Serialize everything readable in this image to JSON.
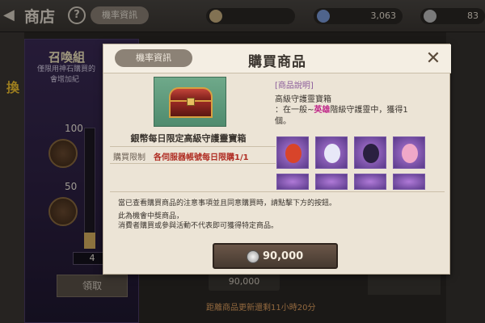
{
  "topbar": {
    "back_glyph": "◀",
    "title": "商店",
    "help_glyph": "?",
    "tab_label": "機率資訊",
    "currencies": [
      {
        "icon": "gem-icon",
        "value": ""
      },
      {
        "icon": "crystal-icon",
        "value": "3,063"
      },
      {
        "icon": "silver-coin-icon",
        "value": "83"
      }
    ]
  },
  "banner": {
    "title": "召喚組",
    "desc_line1": "僅限用神石購買的",
    "desc_line2": "會增加紀",
    "milestones": [
      "100",
      "50"
    ],
    "counter": "4",
    "claim_label": "領取",
    "side_deco": "換"
  },
  "background": {
    "price": "90,000",
    "footer": "距離商品更新還剩11小時20分"
  },
  "modal": {
    "tab_label": "機率資訊",
    "title": "購買商品",
    "close_glyph": "✕",
    "item": {
      "name": "銀幣每日限定高級守護靈寶箱",
      "limit_label": "購買限制",
      "limit_value": "各伺服器帳號每日限購1/1"
    },
    "description": {
      "heading": "[商品說明]",
      "name": "高級守護靈寶箱",
      "text_pre": "：在一般~",
      "text_hero": "英雄",
      "text_post": "階級守護靈中，獲得1",
      "text_line2": "個。",
      "thumbs": [
        "guardian-1",
        "guardian-2",
        "guardian-3",
        "guardian-4"
      ]
    },
    "notice": {
      "main": "當已查看購買商品的注意事項並且同意購買時，請點擊下方的按鈕。",
      "sub1": "此為機會中獎商品，",
      "sub2": "消費者購買或參與活動不代表即可獲得特定商品。"
    },
    "buy": {
      "price": "90,000"
    }
  },
  "colors": {
    "accent": "#b02e24",
    "hero": "#c02a8a",
    "modal_bg": "#ece4d6"
  }
}
